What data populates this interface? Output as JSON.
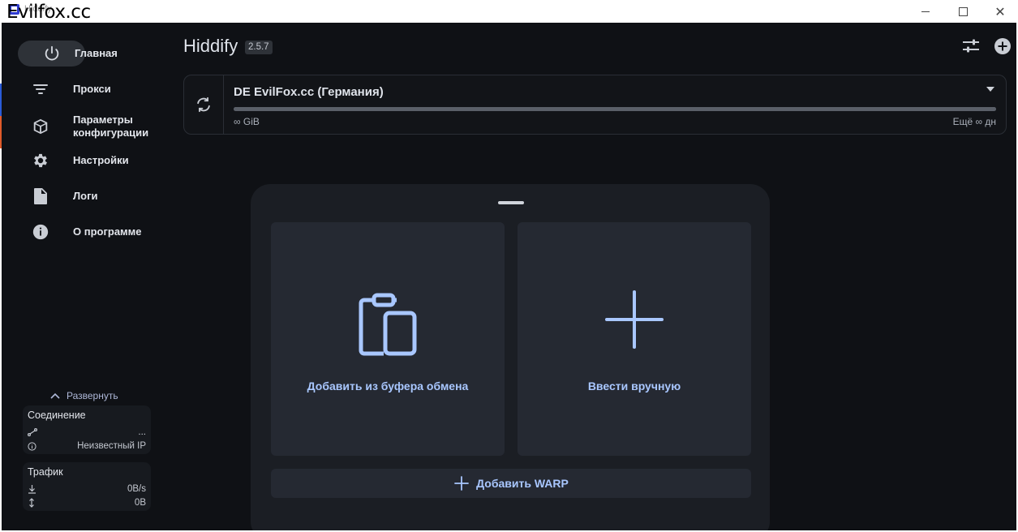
{
  "window": {
    "title_small": "Hiddify",
    "title_overlay": "Evilfox.cc"
  },
  "header": {
    "app_name": "Hiddify",
    "version": "2.5.7"
  },
  "sidebar": {
    "items": [
      {
        "label": "Главная",
        "icon": "power-icon",
        "active": true
      },
      {
        "label": "Прокси",
        "icon": "filter-lines-icon"
      },
      {
        "label": "Параметры конфигурации",
        "icon": "box-icon"
      },
      {
        "label": "Настройки",
        "icon": "gear-icon"
      },
      {
        "label": "Логи",
        "icon": "document-icon"
      },
      {
        "label": "О программе",
        "icon": "info-icon"
      }
    ],
    "expand_label": "Развернуть",
    "connection": {
      "title": "Соединение",
      "route_value": "...",
      "ip_value": "Неизвестный IP"
    },
    "traffic": {
      "title": "Трафик",
      "speed": "0B/s",
      "total": "0B"
    }
  },
  "profile": {
    "name": "DE EvilFox.cc (Германия)",
    "data_left": "∞ GiB",
    "time_left": "Ещё ∞ дн",
    "usage_fraction": 1.0
  },
  "sheet": {
    "option_clipboard": "Добавить из буфера обмена",
    "option_manual": "Ввести вручную",
    "warp_label": "Добавить WARP"
  },
  "colors": {
    "background": "#0f1115",
    "accent": "#a9c7ff",
    "card": "#252932"
  }
}
